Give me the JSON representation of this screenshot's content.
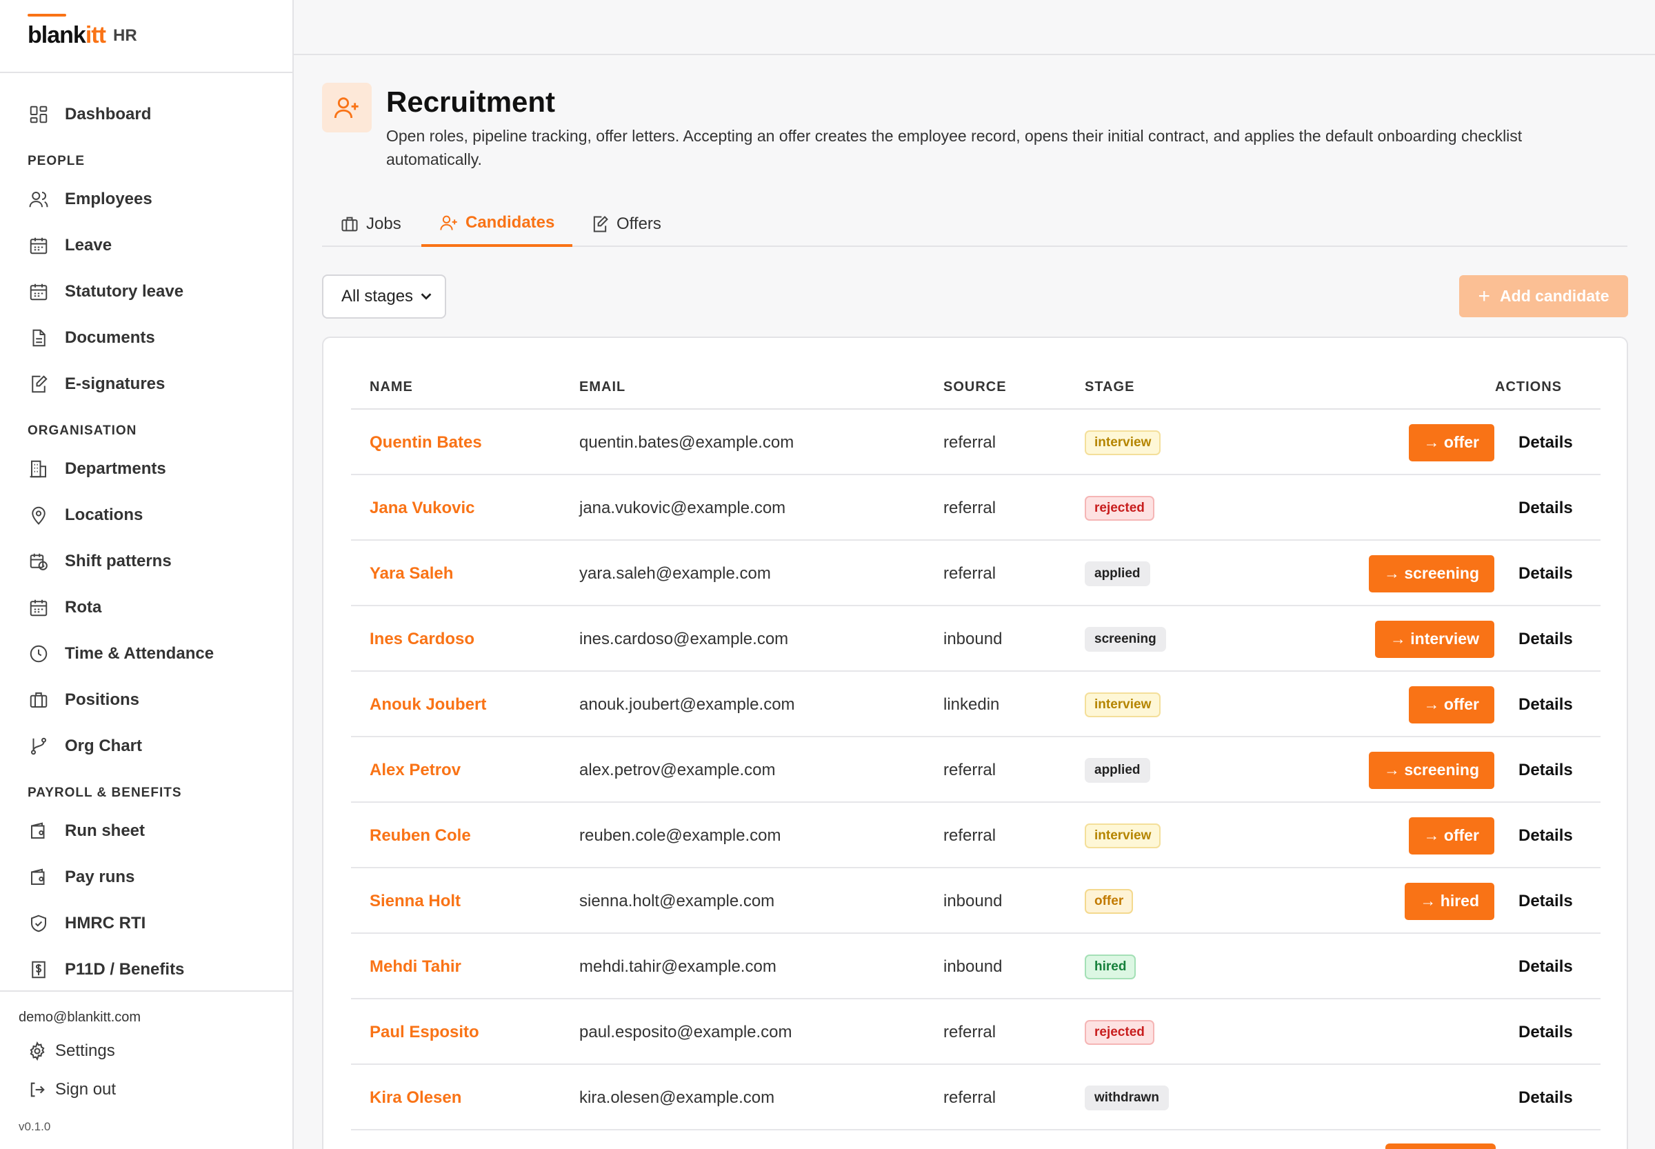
{
  "brand": {
    "logo_main": "blank",
    "logo_accent": "itt",
    "product": "HR"
  },
  "sidebar": {
    "top": [
      {
        "label": "Dashboard",
        "icon": "dashboard-icon"
      }
    ],
    "sections": [
      {
        "title": "PEOPLE",
        "items": [
          {
            "label": "Employees",
            "icon": "users-icon"
          },
          {
            "label": "Leave",
            "icon": "calendar-icon"
          },
          {
            "label": "Statutory leave",
            "icon": "calendar-icon"
          },
          {
            "label": "Documents",
            "icon": "document-icon"
          },
          {
            "label": "E-signatures",
            "icon": "signature-icon"
          }
        ]
      },
      {
        "title": "ORGANISATION",
        "items": [
          {
            "label": "Departments",
            "icon": "building-icon"
          },
          {
            "label": "Locations",
            "icon": "map-pin-icon"
          },
          {
            "label": "Shift patterns",
            "icon": "calendar-clock-icon"
          },
          {
            "label": "Rota",
            "icon": "calendar-icon"
          },
          {
            "label": "Time & Attendance",
            "icon": "clock-icon"
          },
          {
            "label": "Positions",
            "icon": "briefcase-icon"
          },
          {
            "label": "Org Chart",
            "icon": "git-branch-icon"
          }
        ]
      },
      {
        "title": "PAYROLL & BENEFITS",
        "items": [
          {
            "label": "Run sheet",
            "icon": "wallet-icon"
          },
          {
            "label": "Pay runs",
            "icon": "wallet-icon"
          },
          {
            "label": "HMRC RTI",
            "icon": "shield-check-icon"
          },
          {
            "label": "P11D / Benefits",
            "icon": "dollar-receipt-icon"
          }
        ]
      }
    ],
    "footer": {
      "email": "demo@blankitt.com",
      "settings": "Settings",
      "signout": "Sign out",
      "version": "v0.1.0"
    }
  },
  "page": {
    "title": "Recruitment",
    "description": "Open roles, pipeline tracking, offer letters. Accepting an offer creates the employee record, opens their initial contract, and applies the default onboarding checklist automatically."
  },
  "tabs": [
    {
      "label": "Jobs",
      "icon": "briefcase-icon",
      "active": false
    },
    {
      "label": "Candidates",
      "icon": "user-plus-icon",
      "active": true
    },
    {
      "label": "Offers",
      "icon": "signature-icon",
      "active": false
    }
  ],
  "filter": {
    "selected": "All stages"
  },
  "add_button": {
    "label": "Add candidate"
  },
  "table": {
    "headers": {
      "name": "NAME",
      "email": "EMAIL",
      "source": "SOURCE",
      "stage": "STAGE",
      "actions": "ACTIONS"
    },
    "rows": [
      {
        "name": "Quentin Bates",
        "email": "quentin.bates@example.com",
        "source": "referral",
        "stage": "interview",
        "action": "→ offer",
        "details": "Details"
      },
      {
        "name": "Jana Vukovic",
        "email": "jana.vukovic@example.com",
        "source": "referral",
        "stage": "rejected",
        "action": "",
        "details": "Details"
      },
      {
        "name": "Yara Saleh",
        "email": "yara.saleh@example.com",
        "source": "referral",
        "stage": "applied",
        "action": "→ screening",
        "details": "Details"
      },
      {
        "name": "Ines Cardoso",
        "email": "ines.cardoso@example.com",
        "source": "inbound",
        "stage": "screening",
        "action": "→ interview",
        "details": "Details"
      },
      {
        "name": "Anouk Joubert",
        "email": "anouk.joubert@example.com",
        "source": "linkedin",
        "stage": "interview",
        "action": "→ offer",
        "details": "Details"
      },
      {
        "name": "Alex Petrov",
        "email": "alex.petrov@example.com",
        "source": "referral",
        "stage": "applied",
        "action": "→ screening",
        "details": "Details"
      },
      {
        "name": "Reuben Cole",
        "email": "reuben.cole@example.com",
        "source": "referral",
        "stage": "interview",
        "action": "→ offer",
        "details": "Details"
      },
      {
        "name": "Sienna Holt",
        "email": "sienna.holt@example.com",
        "source": "inbound",
        "stage": "offer",
        "action": "→ hired",
        "details": "Details"
      },
      {
        "name": "Mehdi Tahir",
        "email": "mehdi.tahir@example.com",
        "source": "inbound",
        "stage": "hired",
        "action": "",
        "details": "Details"
      },
      {
        "name": "Paul Esposito",
        "email": "paul.esposito@example.com",
        "source": "referral",
        "stage": "rejected",
        "action": "",
        "details": "Details"
      },
      {
        "name": "Kira Olesen",
        "email": "kira.olesen@example.com",
        "source": "referral",
        "stage": "withdrawn",
        "action": "",
        "details": "Details"
      }
    ]
  },
  "colors": {
    "accent": "#f97316",
    "accent_disabled": "#fbbf94"
  }
}
